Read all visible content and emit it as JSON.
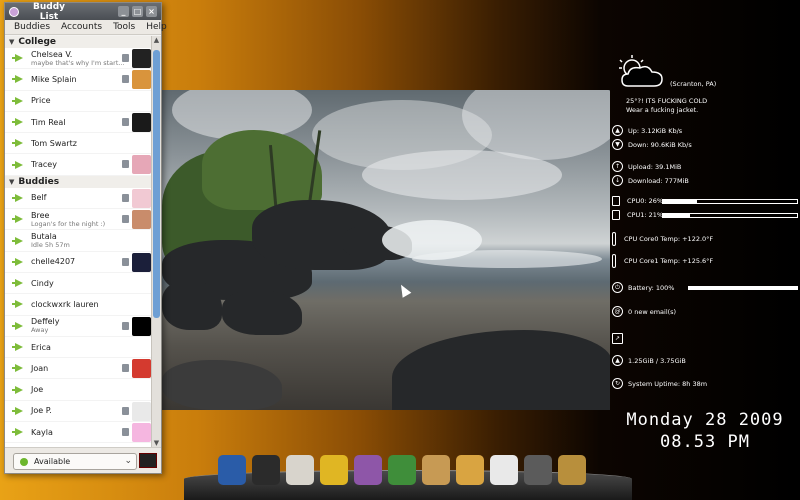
{
  "buddy_list": {
    "title": "Buddy List",
    "menu": [
      "Buddies",
      "Accounts",
      "Tools",
      "Help"
    ],
    "groups": [
      {
        "name": "College",
        "buddies": [
          {
            "name": "Chelsea V.",
            "status_msg": "maybe that's why I'm start...",
            "avatar_color": "#222222"
          },
          {
            "name": "Mike Splain",
            "status_msg": "",
            "avatar_color": "#d9943c"
          },
          {
            "name": "Price",
            "status_msg": "",
            "avatar_color": ""
          },
          {
            "name": "Tim Real",
            "status_msg": "",
            "avatar_color": "#1a1a1a"
          },
          {
            "name": "Tom Swartz",
            "status_msg": "",
            "avatar_color": ""
          },
          {
            "name": "Tracey",
            "status_msg": "",
            "avatar_color": "#e6a7b7"
          }
        ]
      },
      {
        "name": "Buddies",
        "buddies": [
          {
            "name": "Belf",
            "status_msg": "",
            "avatar_color": "#f1c9d3"
          },
          {
            "name": "Bree",
            "status_msg": "Logan's for the night :)",
            "avatar_color": "#c98c6b"
          },
          {
            "name": "Butala",
            "status_msg": "Idle 5h 57m",
            "avatar_color": ""
          },
          {
            "name": "chelle4207",
            "status_msg": "",
            "avatar_color": "#1b1f3a"
          },
          {
            "name": "Cindy",
            "status_msg": "",
            "avatar_color": ""
          },
          {
            "name": "clockwxrk lauren",
            "status_msg": "",
            "avatar_color": ""
          },
          {
            "name": "Deffely",
            "status_msg": "Away",
            "avatar_color": "#000000"
          },
          {
            "name": "Erica",
            "status_msg": "",
            "avatar_color": ""
          },
          {
            "name": "Joan",
            "status_msg": "",
            "avatar_color": "#d43a2f"
          },
          {
            "name": "Joe",
            "status_msg": "",
            "avatar_color": ""
          },
          {
            "name": "Joe P.",
            "status_msg": "",
            "avatar_color": "#e9e9e9"
          },
          {
            "name": "Kayla",
            "status_msg": "",
            "avatar_color": "#f5b6e0"
          }
        ]
      }
    ],
    "status_selector": "Available"
  },
  "conky": {
    "location": "(Scranton, PA)",
    "weather_line1": "25°?! ITS FUCKING COLD",
    "weather_line2": "Wear a fucking jacket.",
    "up": "Up: 3.12KiB Kb/s",
    "down": "Down: 90.6KiB Kb/s",
    "upload": "Upload: 39.1MiB",
    "download": "Download: 777MiB",
    "cpu0": "CPU0: 26%",
    "cpu0_pct": 26,
    "cpu1": "CPU1: 21%",
    "cpu1_pct": 21,
    "core0": "CPU Core0 Temp: +122.0°F",
    "core1": "CPU Core1 Temp: +125.6°F",
    "battery": "Battery: 100%",
    "battery_pct": 100,
    "email": "0 new email(s)",
    "mem": "1.25GiB / 3.75GiB",
    "uptime": "System Uptime:  8h 38m",
    "date": "Monday 28 2009",
    "time": "08.53 PM"
  },
  "dock": [
    {
      "icon": "firefox-icon",
      "color": "#2a5ca8"
    },
    {
      "icon": "terminal-icon",
      "color": "#2b2b2b"
    },
    {
      "icon": "text-editor-icon",
      "color": "#d8d4cc"
    },
    {
      "icon": "bird-icon",
      "color": "#e0b623"
    },
    {
      "icon": "pidgin-icon",
      "color": "#8e56a8"
    },
    {
      "icon": "chrome-icon",
      "color": "#3f8e3a"
    },
    {
      "icon": "files-icon",
      "color": "#c79a54"
    },
    {
      "icon": "folder-icon",
      "color": "#d9a441"
    },
    {
      "icon": "pandora-icon",
      "color": "#e9e9e9"
    },
    {
      "icon": "media-player-icon",
      "color": "#5b5b5b"
    },
    {
      "icon": "trash-icon",
      "color": "#b88f3c"
    }
  ]
}
